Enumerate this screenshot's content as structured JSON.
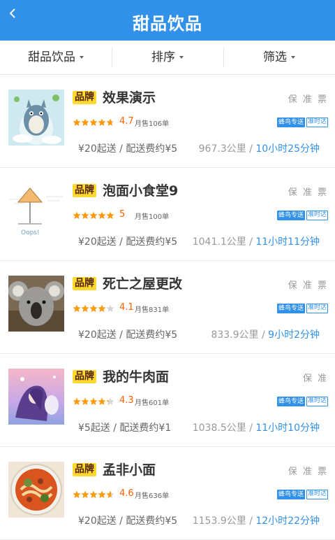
{
  "header": {
    "title": "甜品饮品",
    "back_icon": "chevron-left-icon"
  },
  "filters": [
    "甜品饮品",
    "排序",
    "筛选"
  ],
  "colors": {
    "accent": "#3190e8",
    "brand_badge": "#ffd930",
    "rating": "#ff6000",
    "star": "#ff9a0d"
  },
  "shops": [
    {
      "brand": "品牌",
      "name": "效果演示",
      "guarantees": "保 准 票",
      "rating_value": 4.7,
      "rating": "4.7",
      "sales": "月售106单",
      "tag_delivery": "蜂鸟专送",
      "tag_ontime": "准时达",
      "fee": "¥20起送 / 配送费约¥5",
      "distance": "967.3公里",
      "sep": "/",
      "time": "10小时25分钟",
      "image": "totoro-cartoon"
    },
    {
      "brand": "品牌",
      "name": "泡面小食堂9",
      "guarantees": "保 准 票",
      "rating_value": 5,
      "rating": "5",
      "sales": "月售100单",
      "tag_delivery": "蜂鸟专送",
      "tag_ontime": "准时达",
      "fee": "¥20起送 / 配送费约¥5",
      "distance": "1041.1公里",
      "sep": "/",
      "time": "11小时11分钟",
      "image": "oops-sign"
    },
    {
      "brand": "品牌",
      "name": "死亡之屋更改",
      "guarantees": "保 准 票",
      "rating_value": 4.1,
      "rating": "4.1",
      "sales": "月售831单",
      "tag_delivery": "蜂鸟专送",
      "tag_ontime": "准时达",
      "fee": "¥20起送 / 配送费约¥5",
      "distance": "833.9公里",
      "sep": "/",
      "time": "9小时2分钟",
      "image": "koala"
    },
    {
      "brand": "品牌",
      "name": "我的牛肉面",
      "guarantees": "保 准",
      "rating_value": 4.3,
      "rating": "4.3",
      "sales": "月售601单",
      "tag_delivery": "蜂鸟专送",
      "tag_ontime": "准时达",
      "fee": "¥5起送 / 配送费约¥1",
      "distance": "1038.5公里",
      "sep": "/",
      "time": "11小时10分钟",
      "image": "anime-girl"
    },
    {
      "brand": "品牌",
      "name": "孟非小面",
      "guarantees": "保 准 票",
      "rating_value": 4.6,
      "rating": "4.6",
      "sales": "月售636单",
      "tag_delivery": "蜂鸟专送",
      "tag_ontime": "准时达",
      "fee": "¥20起送 / 配送费约¥5",
      "distance": "1153.9公里",
      "sep": "/",
      "time": "12小时22分钟",
      "image": "noodle-bowl"
    }
  ]
}
